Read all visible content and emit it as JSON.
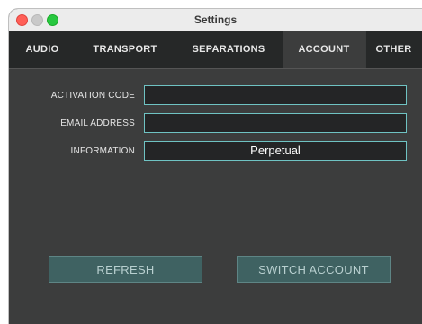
{
  "window": {
    "title": "Settings"
  },
  "tabs": [
    {
      "label": "AUDIO"
    },
    {
      "label": "TRANSPORT"
    },
    {
      "label": "SEPARATIONS"
    },
    {
      "label": "ACCOUNT",
      "active": true
    },
    {
      "label": "OTHER"
    }
  ],
  "account": {
    "activation_code": {
      "label": "ACTIVATION CODE",
      "value": ""
    },
    "email_address": {
      "label": "EMAIL ADDRESS",
      "value": ""
    },
    "information": {
      "label": "INFORMATION",
      "value": "Perpetual"
    }
  },
  "buttons": {
    "refresh": "REFRESH",
    "switch_account": "SWITCH ACCOUNT"
  },
  "colors": {
    "background": "#3c3d3d",
    "tab_bar": "#262828",
    "field_border": "#6fc3c3",
    "button": "#3f6262"
  }
}
